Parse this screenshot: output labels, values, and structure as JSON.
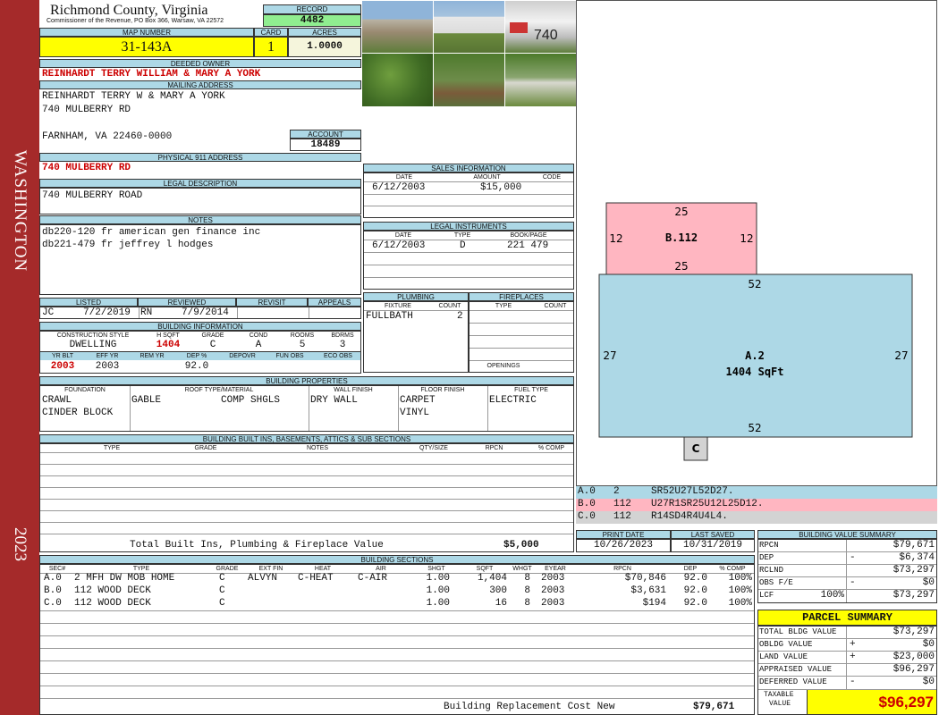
{
  "sidebar": {
    "district": "WASHINGTON",
    "year": "2023"
  },
  "header": {
    "county": "Richmond County, Virginia",
    "commissioner": "Commissioner of the Revenue, PO Box 366, Warsaw, VA 22572",
    "record_label": "RECORD",
    "record": "4482",
    "map_number_label": "MAP NUMBER",
    "map_number": "31-143A",
    "card_label": "CARD",
    "card": "1",
    "acres_label": "ACRES",
    "acres": "1.0000"
  },
  "owner": {
    "deeded_label": "DEEDED OWNER",
    "deeded": "REINHARDT TERRY WILLIAM & MARY A YORK",
    "mailing_label": "MAILING ADDRESS",
    "mail1": "REINHARDT TERRY W & MARY A YORK",
    "mail2": "740 MULBERRY RD",
    "mail3": "FARNHAM, VA 22460-0000",
    "account_label": "ACCOUNT",
    "account": "18489",
    "p911_label": "PHYSICAL 911 ADDRESS",
    "p911": "740 MULBERRY RD"
  },
  "legal": {
    "label": "LEGAL DESCRIPTION",
    "text": "740 MULBERRY ROAD"
  },
  "notes": {
    "label": "NOTES",
    "line1": "db220-120 fr american gen finance inc",
    "line2": "db221-479 fr jeffrey l hodges"
  },
  "sales": {
    "label": "SALES INFORMATION",
    "cols": [
      "DATE",
      "AMOUNT",
      "CODE"
    ],
    "date": "6/12/2003",
    "amount": "$15,000",
    "code": ""
  },
  "instruments": {
    "label": "LEGAL INSTRUMENTS",
    "cols": [
      "DATE",
      "TYPE",
      "BOOK/PAGE"
    ],
    "date": "6/12/2003",
    "type": "D",
    "bookpage": "221 479"
  },
  "listed": {
    "cols": [
      "LISTED",
      "REVIEWED",
      "REVISIT",
      "APPEALS"
    ],
    "listed_by": "JC",
    "listed_date": "7/2/2019",
    "reviewed_by": "RN",
    "reviewed_date": "7/9/2014"
  },
  "bldg_info": {
    "label": "BUILDING INFORMATION",
    "cols": [
      "CONSTRUCTION STYLE",
      "H SQFT",
      "GRADE",
      "COND",
      "ROOMS",
      "BDRMS"
    ],
    "style": "DWELLING",
    "hsqft": "1404",
    "grade": "C",
    "cond": "A",
    "rooms": "5",
    "bdrms": "3",
    "cols2": [
      "YR BLT",
      "EFF YR",
      "REM YR",
      "DEP %",
      "DEPOVR",
      "FUN OBS",
      "ECO OBS"
    ],
    "yrblt": "2003",
    "effyr": "2003",
    "dep": "92.0"
  },
  "plumbing": {
    "label": "PLUMBING",
    "cols": [
      "FIXTURE",
      "COUNT"
    ],
    "fixture": "FULLBATH",
    "count": "2"
  },
  "fireplaces": {
    "label": "FIREPLACES",
    "cols": [
      "TYPE",
      "COUNT"
    ],
    "openings": "OPENINGS"
  },
  "props": {
    "label": "BUILDING PROPERTIES",
    "cols": [
      "FOUNDATION",
      "ROOF TYPE/MATERIAL",
      "WALL FINISH",
      "FLOOR FINISH",
      "FUEL TYPE"
    ],
    "f1": "CRAWL",
    "f2": "CINDER BLOCK",
    "roof1": "GABLE",
    "roof2": "COMP SHGLS",
    "wall": "DRY WALL",
    "floor1": "CARPET",
    "floor2": "VINYL",
    "fuel": "ELECTRIC"
  },
  "builtins": {
    "label": "BUILDING BUILT INS, BASEMENTS, ATTICS & SUB SECTIONS",
    "cols": [
      "TYPE",
      "GRADE",
      "NOTES",
      "QTY/SIZE",
      "RPCN",
      "% COMP"
    ],
    "total_label": "Total Built Ins, Plumbing & Fireplace Value",
    "total": "$5,000"
  },
  "print": {
    "print_label": "PRINT DATE",
    "print_date": "10/26/2023",
    "saved_label": "LAST SAVED",
    "saved_date": "10/31/2019"
  },
  "sections": {
    "label": "BUILDING SECTIONS",
    "cols": [
      "SEC#",
      "TYPE",
      "GRADE",
      "EXT FIN",
      "HEAT",
      "AIR",
      "SHGT",
      "SQFT",
      "WHGT",
      "EYEAR",
      "RPCN",
      "DEP",
      "% COMP"
    ],
    "rows": [
      {
        "sec": "A.0",
        "type": "2 MFH DW MOB HOME",
        "grade": "C",
        "ext": "ALVYN",
        "heat": "C-HEAT",
        "air": "C-AIR",
        "shgt": "1.00",
        "sqft": "1,404",
        "whgt": "8",
        "eyear": "2003",
        "rpcn": "$70,846",
        "dep": "92.0",
        "comp": "100%"
      },
      {
        "sec": "B.0",
        "type": "112 WOOD DECK",
        "grade": "C",
        "ext": "",
        "heat": "",
        "air": "",
        "shgt": "1.00",
        "sqft": "300",
        "whgt": "8",
        "eyear": "2003",
        "rpcn": "$3,631",
        "dep": "92.0",
        "comp": "100%"
      },
      {
        "sec": "C.0",
        "type": "112 WOOD DECK",
        "grade": "C",
        "ext": "",
        "heat": "",
        "air": "",
        "shgt": "1.00",
        "sqft": "16",
        "whgt": "8",
        "eyear": "2003",
        "rpcn": "$194",
        "dep": "92.0",
        "comp": "100%"
      }
    ],
    "brcn_label": "Building Replacement Cost New",
    "brcn": "$79,671"
  },
  "sketch": {
    "b_label": "B.112",
    "b_top": "25",
    "b_bottom": "25",
    "b_left": "12",
    "b_right": "12",
    "a_label": "A.2",
    "a_sqft": "1404 SqFt",
    "a_top": "52",
    "a_bottom": "52",
    "a_left": "27",
    "a_right": "27",
    "c_label": "C",
    "legend": [
      {
        "code": "A.0",
        "num": "2",
        "path": "SR52U27L52D27.",
        "color": "#add8e6"
      },
      {
        "code": "B.0",
        "num": "112",
        "path": "U27R1SR25U12L25D12.",
        "color": "#ffb6c1"
      },
      {
        "code": "C.0",
        "num": "112",
        "path": "R14SD4R4U4L4.",
        "color": "#d3d3d3"
      }
    ]
  },
  "bvs": {
    "label": "BUILDING VALUE SUMMARY",
    "rpcn_l": "RPCN",
    "rpcn": "$79,671",
    "dep_l": "DEP",
    "dep_s": "-",
    "dep": "$6,374",
    "rclnd_l": "RCLND",
    "rclnd": "$73,297",
    "obs_l": "OBS F/E",
    "obs_s": "-",
    "obs": "$0",
    "lcf_l": "LCF",
    "lcf_p": "100%",
    "lcf": "$73,297"
  },
  "summary": {
    "label": "PARCEL SUMMARY",
    "tb_l": "TOTAL BLDG VALUE",
    "tb": "$73,297",
    "ob_l": "OBLDG VALUE",
    "ob_s": "+",
    "ob": "$0",
    "land_l": "LAND VALUE",
    "land_s": "+",
    "land": "$23,000",
    "app_l": "APPRAISED VALUE",
    "app": "$96,297",
    "def_l": "DEFERRED VALUE",
    "def_s": "-",
    "def": "$0",
    "tax_l1": "TAXABLE",
    "tax_l2": "VALUE",
    "tax": "$96,297"
  }
}
